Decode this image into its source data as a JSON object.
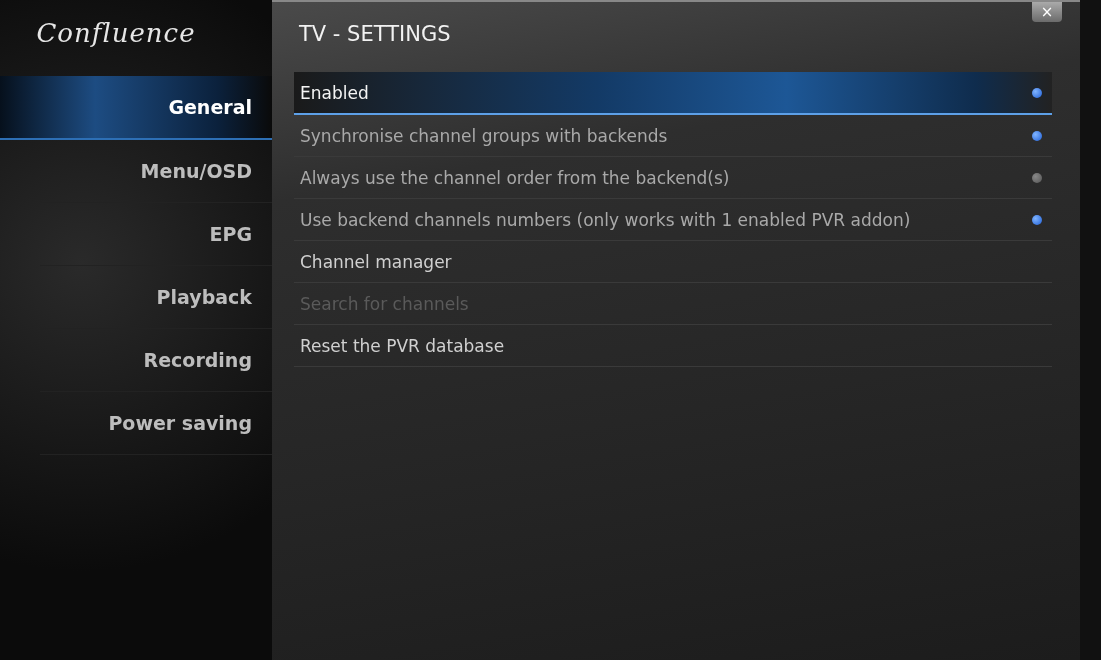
{
  "logo": "Confluence",
  "sidebar": {
    "items": [
      {
        "label": "General",
        "selected": true
      },
      {
        "label": "Menu/OSD",
        "selected": false
      },
      {
        "label": "EPG",
        "selected": false
      },
      {
        "label": "Playback",
        "selected": false
      },
      {
        "label": "Recording",
        "selected": false
      },
      {
        "label": "Power saving",
        "selected": false
      }
    ]
  },
  "window": {
    "title": "TV - SETTINGS",
    "close": "×"
  },
  "settings": [
    {
      "kind": "toggle",
      "label": "Enabled",
      "on": true,
      "selected": true,
      "disabled": false
    },
    {
      "kind": "toggle",
      "label": "Synchronise channel groups with backends",
      "on": true,
      "selected": false,
      "disabled": false
    },
    {
      "kind": "toggle",
      "label": "Always use the channel order from the backend(s)",
      "on": false,
      "selected": false,
      "disabled": false
    },
    {
      "kind": "toggle",
      "label": "Use backend channels numbers (only works with 1 enabled PVR addon)",
      "on": true,
      "selected": false,
      "disabled": false
    },
    {
      "kind": "action",
      "label": "Channel manager",
      "selected": false,
      "disabled": false
    },
    {
      "kind": "action",
      "label": "Search for channels",
      "selected": false,
      "disabled": true
    },
    {
      "kind": "action",
      "label": "Reset the PVR database",
      "selected": false,
      "disabled": false
    }
  ]
}
